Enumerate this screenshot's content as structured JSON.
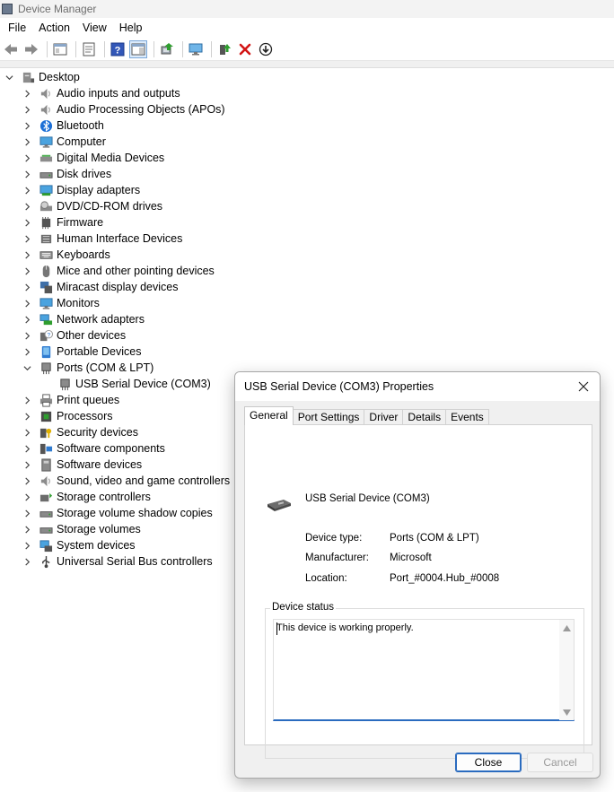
{
  "window": {
    "title": "Device Manager"
  },
  "menu": [
    "File",
    "Action",
    "View",
    "Help"
  ],
  "toolbar": {
    "buttons": [
      "back-icon",
      "forward-icon",
      "show-hide-console-tree-icon",
      "properties-icon",
      "help-icon",
      "show-hide-action-pane-icon",
      "update-driver-icon",
      "scan-hardware-icon",
      "enable-device-icon",
      "uninstall-device-icon",
      "download-icon"
    ]
  },
  "tree": {
    "root": "Desktop",
    "items": [
      {
        "label": "Audio inputs and outputs",
        "icon": "speaker-icon",
        "expanded": false
      },
      {
        "label": "Audio Processing Objects (APOs)",
        "icon": "speaker-icon",
        "expanded": false
      },
      {
        "label": "Bluetooth",
        "icon": "bluetooth-icon",
        "expanded": false
      },
      {
        "label": "Computer",
        "icon": "computer-icon",
        "expanded": false
      },
      {
        "label": "Digital Media Devices",
        "icon": "media-device-icon",
        "expanded": false
      },
      {
        "label": "Disk drives",
        "icon": "disk-drive-icon",
        "expanded": false
      },
      {
        "label": "Display adapters",
        "icon": "display-adapter-icon",
        "expanded": false
      },
      {
        "label": "DVD/CD-ROM drives",
        "icon": "optical-drive-icon",
        "expanded": false
      },
      {
        "label": "Firmware",
        "icon": "chip-icon",
        "expanded": false
      },
      {
        "label": "Human Interface Devices",
        "icon": "hid-icon",
        "expanded": false
      },
      {
        "label": "Keyboards",
        "icon": "keyboard-icon",
        "expanded": false
      },
      {
        "label": "Mice and other pointing devices",
        "icon": "mouse-icon",
        "expanded": false
      },
      {
        "label": "Miracast display devices",
        "icon": "miracast-icon",
        "expanded": false
      },
      {
        "label": "Monitors",
        "icon": "monitor-icon",
        "expanded": false
      },
      {
        "label": "Network adapters",
        "icon": "network-icon",
        "expanded": false
      },
      {
        "label": "Other devices",
        "icon": "unknown-device-icon",
        "expanded": false
      },
      {
        "label": "Portable Devices",
        "icon": "portable-device-icon",
        "expanded": false
      },
      {
        "label": "Ports (COM & LPT)",
        "icon": "port-icon",
        "expanded": true,
        "children": [
          {
            "label": "USB Serial Device (COM3)",
            "icon": "port-icon"
          }
        ]
      },
      {
        "label": "Print queues",
        "icon": "printer-icon",
        "expanded": false
      },
      {
        "label": "Processors",
        "icon": "processor-icon",
        "expanded": false
      },
      {
        "label": "Security devices",
        "icon": "security-key-icon",
        "expanded": false
      },
      {
        "label": "Software components",
        "icon": "software-component-icon",
        "expanded": false
      },
      {
        "label": "Software devices",
        "icon": "software-device-icon",
        "expanded": false
      },
      {
        "label": "Sound, video and game controllers",
        "icon": "speaker-icon",
        "expanded": false
      },
      {
        "label": "Storage controllers",
        "icon": "storage-controller-icon",
        "expanded": false
      },
      {
        "label": "Storage volume shadow copies",
        "icon": "disk-drive-icon",
        "expanded": false
      },
      {
        "label": "Storage volumes",
        "icon": "disk-drive-icon",
        "expanded": false
      },
      {
        "label": "System devices",
        "icon": "system-device-icon",
        "expanded": false
      },
      {
        "label": "Universal Serial Bus controllers",
        "icon": "usb-icon",
        "expanded": false
      }
    ]
  },
  "dialog": {
    "title": "USB Serial Device (COM3) Properties",
    "tabs": [
      "General",
      "Port Settings",
      "Driver",
      "Details",
      "Events"
    ],
    "active_tab": "General",
    "device_name": "USB Serial Device (COM3)",
    "properties": [
      {
        "label": "Device type:",
        "value": "Ports (COM & LPT)"
      },
      {
        "label": "Manufacturer:",
        "value": "Microsoft"
      },
      {
        "label": "Location:",
        "value": "Port_#0004.Hub_#0008"
      }
    ],
    "status_label": "Device status",
    "status_text": "This device is working properly.",
    "close_label": "Close",
    "cancel_label": "Cancel"
  },
  "colors": {
    "accent": "#2a6bbf",
    "bluetooth": "#1c6fd6",
    "uninstall_red": "#d21414",
    "enable_green": "#2f9e2f"
  }
}
